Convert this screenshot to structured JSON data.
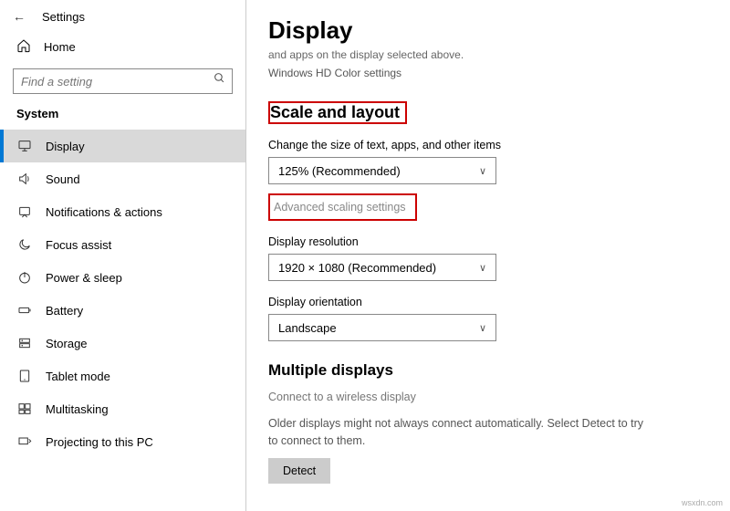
{
  "header": {
    "title": "Settings"
  },
  "home_label": "Home",
  "search": {
    "placeholder": "Find a setting"
  },
  "group": "System",
  "nav": [
    {
      "label": "Display",
      "active": true
    },
    {
      "label": "Sound"
    },
    {
      "label": "Notifications & actions"
    },
    {
      "label": "Focus assist"
    },
    {
      "label": "Power & sleep"
    },
    {
      "label": "Battery"
    },
    {
      "label": "Storage"
    },
    {
      "label": "Tablet mode"
    },
    {
      "label": "Multitasking"
    },
    {
      "label": "Projecting to this PC"
    }
  ],
  "main": {
    "title": "Display",
    "cropped_line": "and apps on the display selected above.",
    "hd_link": "Windows HD Color settings",
    "scale_heading": "Scale and layout",
    "scale_label": "Change the size of text, apps, and other items",
    "scale_value": "125% (Recommended)",
    "advanced_link": "Advanced scaling settings",
    "resolution_label": "Display resolution",
    "resolution_value": "1920 × 1080 (Recommended)",
    "orientation_label": "Display orientation",
    "orientation_value": "Landscape",
    "multiple_heading": "Multiple displays",
    "wireless_link": "Connect to a wireless display",
    "older_text": "Older displays might not always connect automatically. Select Detect to try to connect to them.",
    "detect_label": "Detect"
  },
  "watermark": "wsxdn.com"
}
